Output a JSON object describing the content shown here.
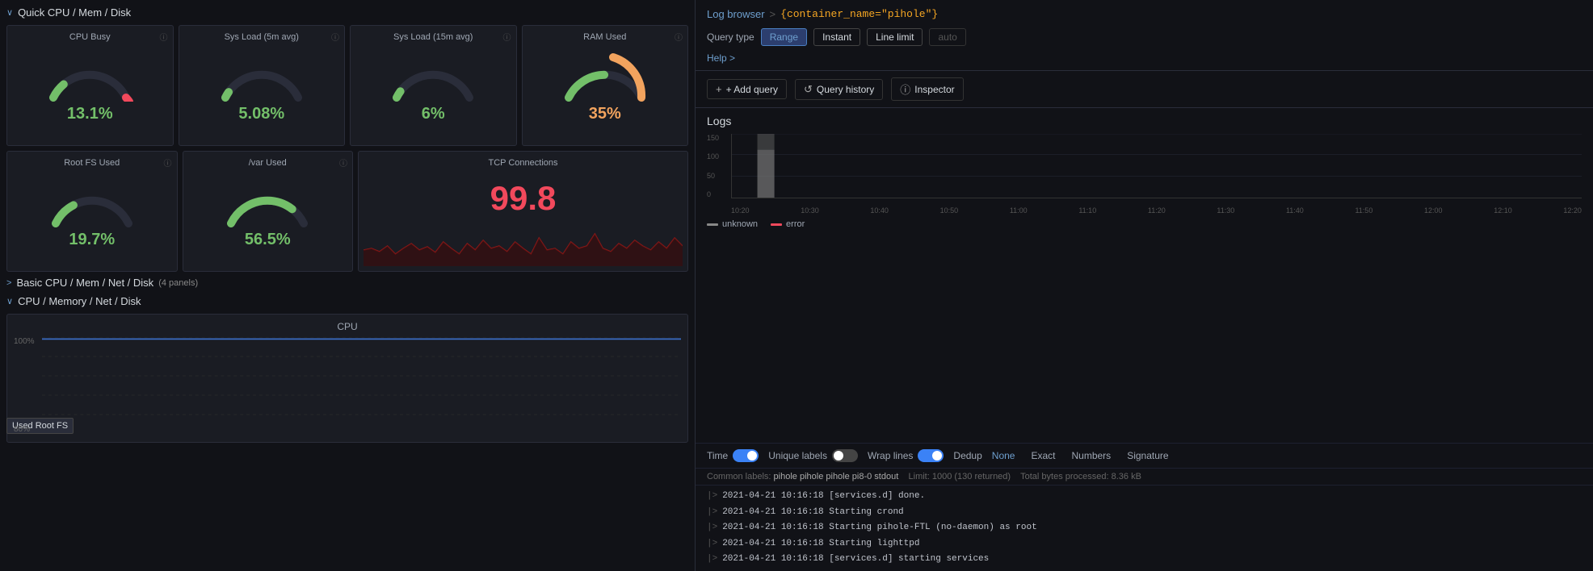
{
  "left": {
    "section1_title": "Quick CPU / Mem / Disk",
    "section2_title": "Basic CPU / Mem / Net / Disk",
    "section2_panels": "(4 panels)",
    "section3_title": "CPU / Memory / Net / Disk",
    "gauges_row1": [
      {
        "title": "CPU Busy",
        "value": "13.1%",
        "value_color": "green",
        "arc_pct": 13
      },
      {
        "title": "Sys Load (5m avg)",
        "value": "5.08%",
        "value_color": "green",
        "arc_pct": 5
      },
      {
        "title": "Sys Load (15m avg)",
        "value": "6%",
        "value_color": "green",
        "arc_pct": 6
      },
      {
        "title": "RAM Used",
        "value": "35%",
        "value_color": "orange",
        "arc_pct": 35
      }
    ],
    "tooltip_label": "Used Root FS",
    "gauges_row2": [
      {
        "title": "Root FS Used",
        "value": "19.7%",
        "value_color": "green",
        "arc_pct": 20
      },
      {
        "title": "/var Used",
        "value": "56.5%",
        "value_color": "green",
        "arc_pct": 57
      }
    ],
    "tcp_title": "TCP Connections",
    "tcp_value": "99.8",
    "cpu_chart_title": "CPU",
    "cpu_y_labels": [
      "100%",
      "80%"
    ]
  },
  "right": {
    "breadcrumb_link": "Log browser",
    "breadcrumb_sep": ">",
    "query_badge": "{container_name=\"pihole\"}",
    "query_type_label": "Query type",
    "query_buttons": [
      {
        "label": "Range",
        "active": true
      },
      {
        "label": "Instant",
        "active": false
      },
      {
        "label": "Line limit",
        "active": false
      },
      {
        "label": "auto",
        "active": false,
        "muted": true
      }
    ],
    "help_label": "Help >",
    "add_query_label": "+ Add query",
    "query_history_label": "Query history",
    "inspector_label": "Inspector",
    "logs_section_title": "Logs",
    "logs_y_labels": [
      "150",
      "100",
      "50",
      "0"
    ],
    "logs_x_labels": [
      "10:20",
      "10:30",
      "10:40",
      "10:50",
      "11:00",
      "11:10",
      "11:20",
      "11:30",
      "11:40",
      "11:50",
      "12:00",
      "12:10",
      "12:20"
    ],
    "legend": [
      {
        "key": "unknown",
        "label": "unknown",
        "color_class": "unknown"
      },
      {
        "key": "error",
        "label": "error",
        "color_class": "error"
      }
    ],
    "controls": {
      "time_label": "Time",
      "time_toggle": "on",
      "unique_labels_label": "Unique labels",
      "unique_labels_toggle": "off",
      "wrap_lines_label": "Wrap lines",
      "wrap_lines_toggle": "on",
      "dedup_label": "Dedup",
      "dedup_options": [
        "None",
        "Exact",
        "Numbers",
        "Signature"
      ],
      "dedup_active": "None"
    },
    "common_labels_prefix": "Common labels:",
    "common_labels_values": "pihole pihole pihole pi8-0 stdout",
    "limit_text": "Limit: 1000 (130 returned)",
    "total_bytes_text": "Total bytes processed: 8.36 kB",
    "log_entries": [
      "2021-04-21 10:16:18 [services.d] done.",
      "2021-04-21 10:16:18 Starting crond",
      "2021-04-21 10:16:18 Starting pihole-FTL (no-daemon) as root",
      "2021-04-21 10:16:18 Starting lighttpd",
      "2021-04-21 10:16:18 [services.d] starting services"
    ]
  }
}
